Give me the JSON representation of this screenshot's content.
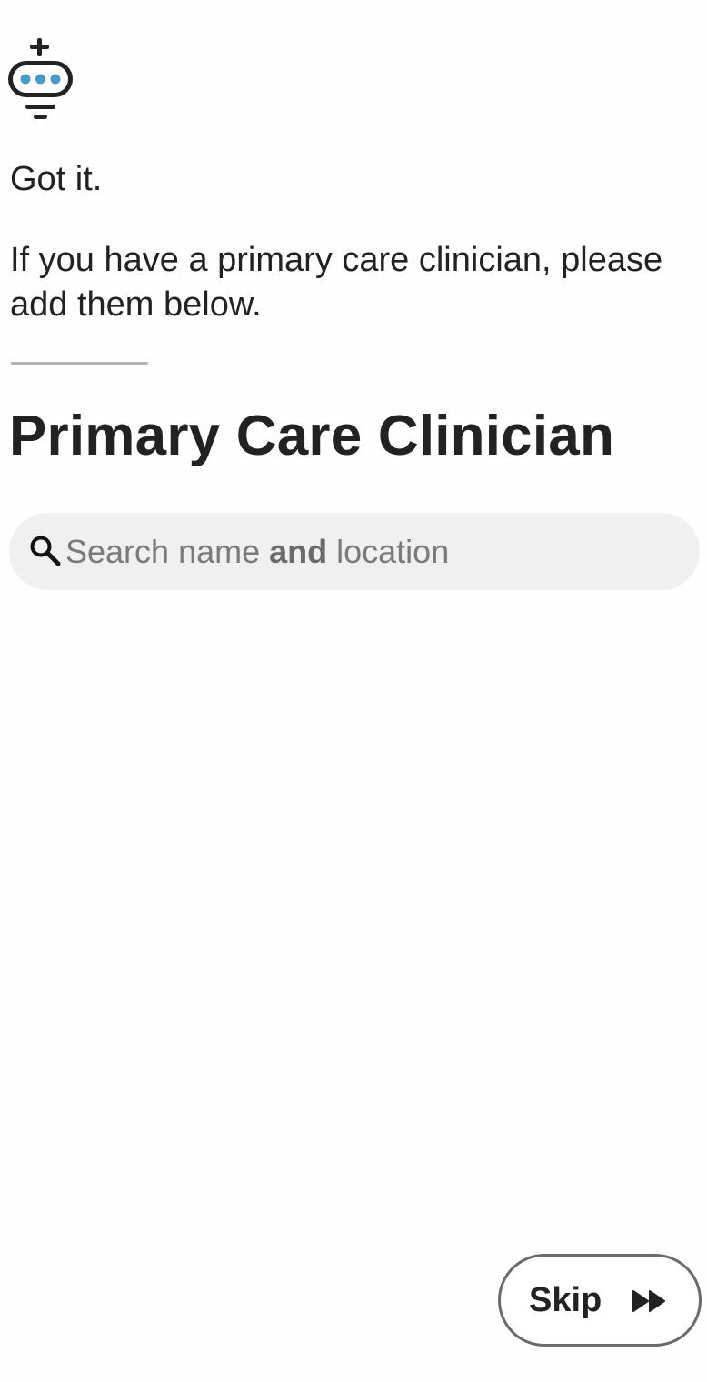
{
  "chat": {
    "bot_icon": "robot-assistant-icon",
    "ack_message": "Got it.",
    "prompt_message": "If you have a primary care clinician, please add them below."
  },
  "section": {
    "title": "Primary Care Clinician"
  },
  "search": {
    "icon": "search-icon",
    "placeholder_part1": "Search name ",
    "placeholder_bold": "and",
    "placeholder_part2": " location",
    "value": ""
  },
  "skip_button": {
    "label": "Skip",
    "icon": "fast-forward-icon"
  },
  "colors": {
    "text": "#222222",
    "accent_dots": "#4a9cc7",
    "search_bg": "#f0f0f0",
    "divider": "#b4b4b4",
    "button_border": "#6b6b6b"
  }
}
